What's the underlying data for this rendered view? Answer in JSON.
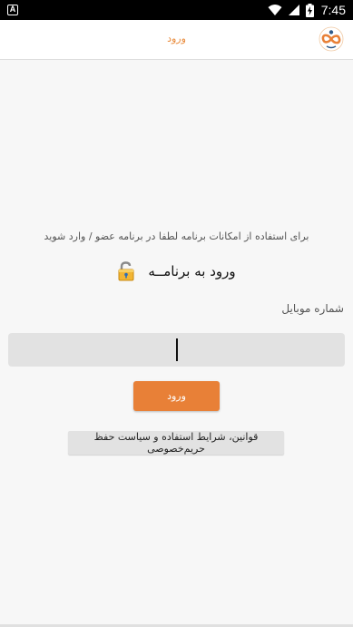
{
  "status_bar": {
    "notification_badge": "A",
    "time": "7:45",
    "icons": [
      "wifi-icon",
      "signal-icon",
      "battery-charging-icon"
    ]
  },
  "app_bar": {
    "title": "ورود",
    "logo": "infinity-logo-icon"
  },
  "login": {
    "intro_text": "برای استفاده از امکانات برنامه لطفا در برنامه عضو / وارد شوید",
    "heading": "ورود به برنامــه",
    "mobile_label": "شماره موبایل",
    "mobile_value": "",
    "submit_label": "ورود",
    "terms_label": "قوانین، شرایط استفاده و سیاست حفظ حریم‌خصوصی"
  },
  "colors": {
    "accent": "#e88037",
    "background": "#f7f7f7",
    "input_bg": "#e2e2e2"
  }
}
